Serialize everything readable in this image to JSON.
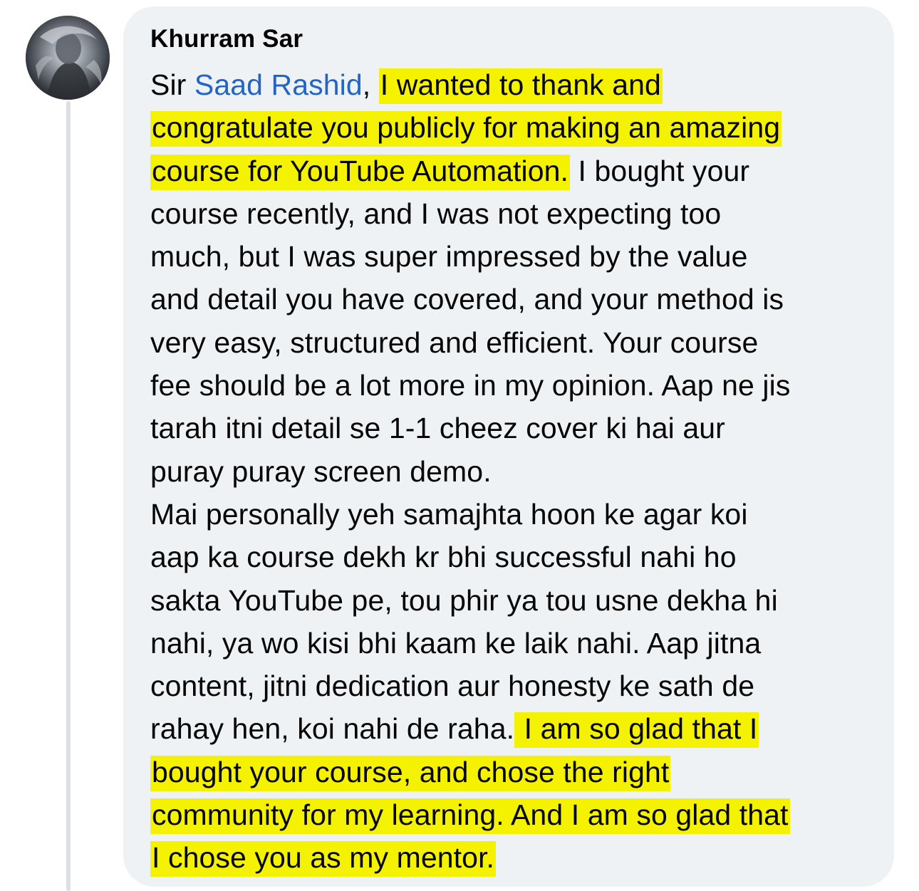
{
  "comment": {
    "author": "Khurram Sar",
    "mention": "Saad Rashid",
    "lines": [
      {
        "segments": [
          {
            "text": "Sir ",
            "style": "plain"
          },
          {
            "text": "Saad Rashid",
            "style": "mention"
          },
          {
            "text": ", ",
            "style": "plain"
          },
          {
            "text": "I wanted to thank and",
            "style": "highlight"
          }
        ]
      },
      {
        "segments": [
          {
            "text": "congratulate you publicly for making an amazing",
            "style": "highlight"
          }
        ]
      },
      {
        "segments": [
          {
            "text": "course for YouTube Automation.",
            "style": "highlight"
          },
          {
            "text": " I bought your",
            "style": "plain"
          }
        ]
      },
      {
        "segments": [
          {
            "text": "course recently, and I was not expecting too",
            "style": "plain"
          }
        ]
      },
      {
        "segments": [
          {
            "text": "much, but I was super impressed by the value",
            "style": "plain"
          }
        ]
      },
      {
        "segments": [
          {
            "text": "and detail you have covered, and your method is",
            "style": "plain"
          }
        ]
      },
      {
        "segments": [
          {
            "text": "very easy, structured and efficient. Your course",
            "style": "plain"
          }
        ]
      },
      {
        "segments": [
          {
            "text": "fee should be a lot more in my opinion. Aap ne jis",
            "style": "plain"
          }
        ]
      },
      {
        "segments": [
          {
            "text": "tarah itni detail se 1-1 cheez cover ki hai aur",
            "style": "plain"
          }
        ]
      },
      {
        "segments": [
          {
            "text": "puray puray screen demo.",
            "style": "plain"
          }
        ]
      },
      {
        "segments": [
          {
            "text": "Mai personally yeh samajhta hoon ke agar koi",
            "style": "plain"
          }
        ]
      },
      {
        "segments": [
          {
            "text": "aap ka course dekh kr bhi successful nahi ho",
            "style": "plain"
          }
        ]
      },
      {
        "segments": [
          {
            "text": "sakta YouTube pe, tou phir ya tou usne dekha hi",
            "style": "plain"
          }
        ]
      },
      {
        "segments": [
          {
            "text": "nahi, ya wo kisi bhi kaam ke laik nahi. Aap jitna",
            "style": "plain"
          }
        ]
      },
      {
        "segments": [
          {
            "text": "content, jitni dedication aur honesty ke sath de",
            "style": "plain"
          }
        ]
      },
      {
        "segments": [
          {
            "text": "rahay hen, koi nahi de raha.",
            "style": "plain"
          },
          {
            "text": " I am so glad that I",
            "style": "highlight"
          }
        ]
      },
      {
        "segments": [
          {
            "text": "bought your course, and chose the right",
            "style": "highlight"
          }
        ]
      },
      {
        "segments": [
          {
            "text": "community for my learning. And I am so glad that",
            "style": "highlight"
          }
        ]
      },
      {
        "segments": [
          {
            "text": "I chose you as my mentor.",
            "style": "highlight"
          }
        ]
      }
    ]
  },
  "colors": {
    "bubble_background": "#eff2f5",
    "highlight": "#f5f200",
    "mention": "#2364c4",
    "text": "#050505",
    "thread_line": "#dcdfe4"
  },
  "icons": {
    "avatar": "profile-photo"
  }
}
